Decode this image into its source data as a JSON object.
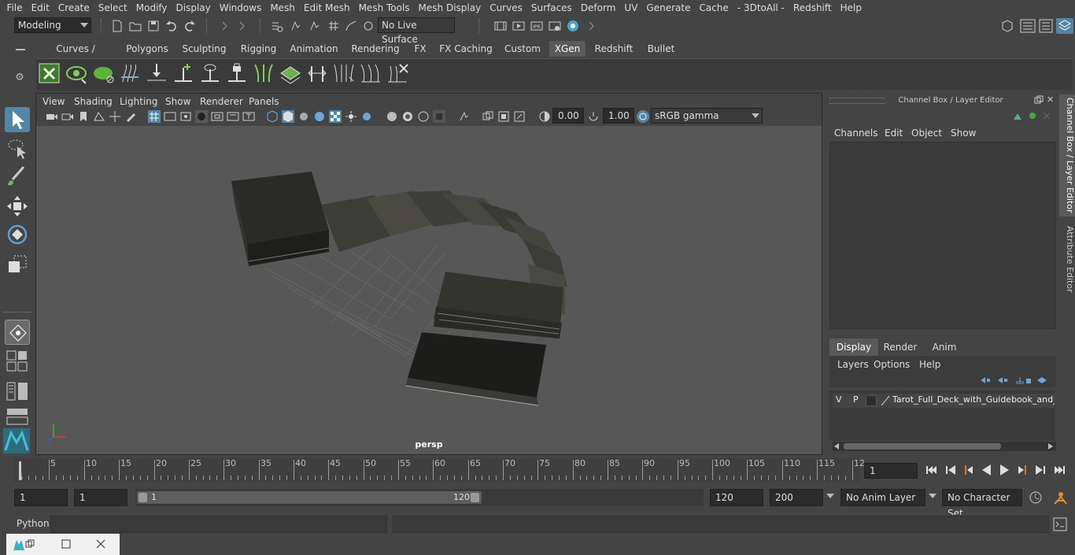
{
  "menubar": {
    "items": [
      "File",
      "Edit",
      "Create",
      "Select",
      "Modify",
      "Display",
      "Windows",
      "Mesh",
      "Edit Mesh",
      "Mesh Tools",
      "Mesh Display",
      "Curves",
      "Surfaces",
      "Deform",
      "UV",
      "Generate",
      "Cache",
      "- 3DtoAll -",
      "Redshift",
      "Help"
    ]
  },
  "statusline": {
    "mode": "Modeling",
    "live_surface": "No Live Surface"
  },
  "shelf": {
    "tabs": [
      "Curves / Surfaces",
      "Polygons",
      "Sculpting",
      "Rigging",
      "Animation",
      "Rendering",
      "FX",
      "FX Caching",
      "Custom",
      "XGen",
      "Redshift",
      "Bullet"
    ],
    "active_tab": "XGen"
  },
  "viewport": {
    "menus": [
      "View",
      "Shading",
      "Lighting",
      "Show",
      "Renderer",
      "Panels"
    ],
    "exposure": "0.00",
    "gamma": "1.00",
    "color_space": "sRGB gamma",
    "camera_label": "persp"
  },
  "channel_box": {
    "title": "Channel Box / Layer Editor",
    "menus": [
      "Channels",
      "Edit",
      "Object",
      "Show"
    ]
  },
  "layer_editor": {
    "tabs": [
      "Display",
      "Render",
      "Anim"
    ],
    "active_tab": "Display",
    "menus": [
      "Layers",
      "Options",
      "Help"
    ],
    "layer": {
      "v": "V",
      "p": "P",
      "name": "Tarot_Full_Deck_with_Guidebook_and_E"
    }
  },
  "side_tabs": {
    "channel_box": "Channel Box / Layer Editor",
    "attribute_editor": "Attribute Editor"
  },
  "timeline": {
    "ticks": [
      "5",
      "10",
      "15",
      "20",
      "25",
      "30",
      "35",
      "40",
      "45",
      "50",
      "55",
      "60",
      "65",
      "70",
      "75",
      "80",
      "85",
      "90",
      "95",
      "100",
      "105",
      "110",
      "115",
      "12"
    ],
    "start_label": "1",
    "current_frame": "1"
  },
  "range": {
    "start": "1",
    "playback_start": "1",
    "slider_start": "1",
    "slider_end": "120",
    "playback_end": "120",
    "end": "200",
    "anim_layer": "No Anim Layer",
    "character_set": "No Character Set"
  },
  "command_line": {
    "label": "Python"
  },
  "colors": {
    "bg": "#444444",
    "viewport": "#575757",
    "accent_blue": "#5285a6",
    "active_tab": "#5a5a5a"
  }
}
